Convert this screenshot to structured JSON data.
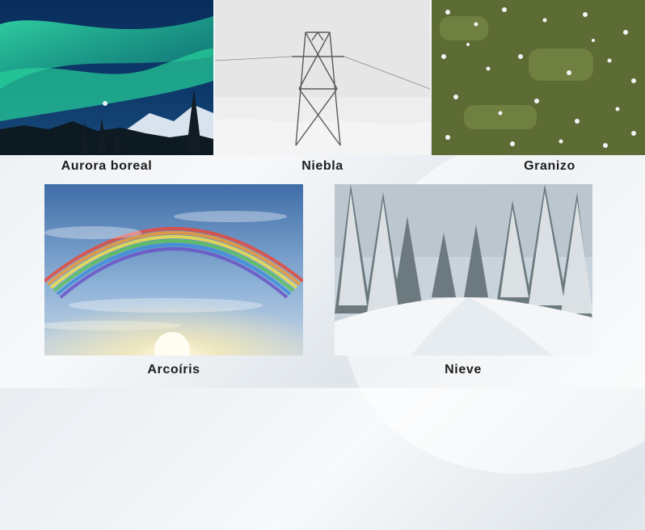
{
  "panels": [
    {
      "label": "Aurora boreal"
    },
    {
      "label": "Niebla"
    },
    {
      "label": "Granizo"
    },
    {
      "label": "Arcoíris"
    },
    {
      "label": "Nieve"
    }
  ]
}
